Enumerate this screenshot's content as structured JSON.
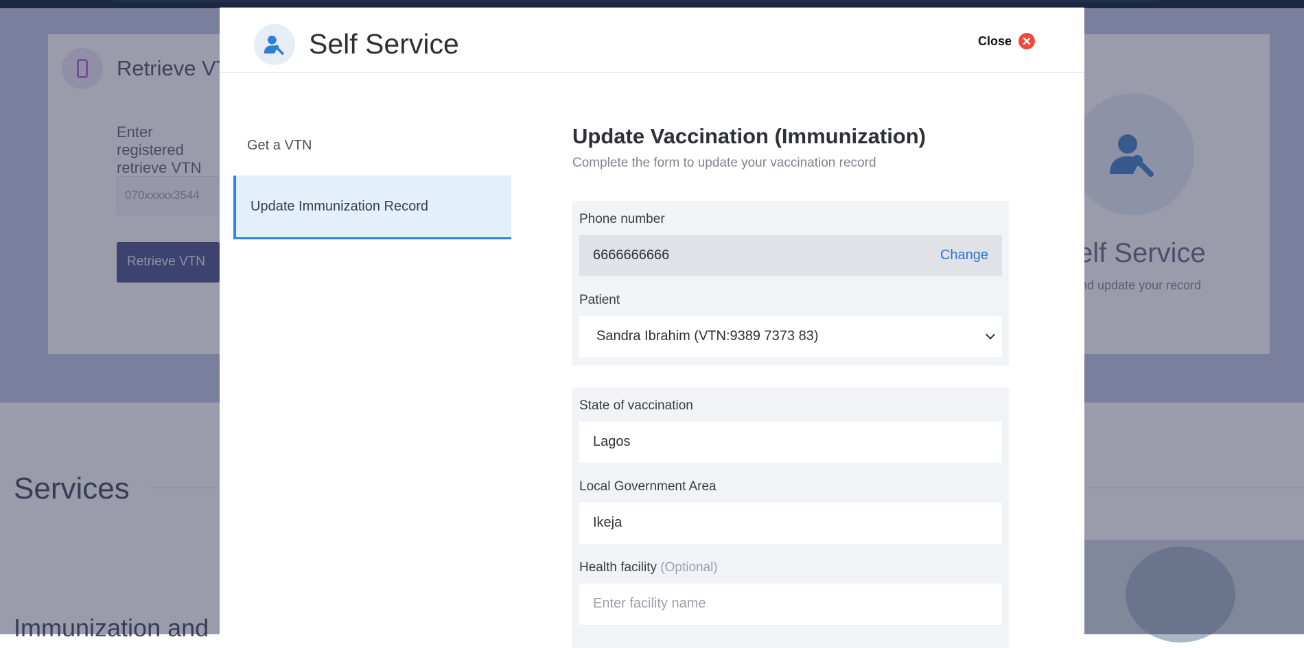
{
  "background": {
    "card_title": "Retrieve VT",
    "card_text": "Enter registered retrieve VTN",
    "input_placeholder": "070xxxxx3544",
    "button_label": "Retrieve VTN",
    "right_title": "elf Service",
    "right_subtitle": "r and update your record",
    "services_heading": "Services",
    "immunization_heading": "Immunization and"
  },
  "modal": {
    "title": "Self Service",
    "close_label": "Close",
    "nav": [
      {
        "label": "Get a VTN",
        "active": false
      },
      {
        "label": "Update Immunization Record",
        "active": true
      }
    ],
    "form": {
      "title": "Update Vaccination (Immunization)",
      "subtitle": "Complete the form to update your vaccination record",
      "phone_label": "Phone number",
      "phone_value": "6666666666",
      "change_label": "Change",
      "patient_label": "Patient",
      "patient_value": "Sandra Ibrahim (VTN:9389 7373 83)",
      "state_label": "State of vaccination",
      "state_value": "Lagos",
      "lga_label": "Local Government Area",
      "lga_value": "Ikeja",
      "facility_label": "Health facility",
      "facility_optional": "(Optional)",
      "facility_placeholder": "Enter facility name"
    }
  },
  "colors": {
    "accent": "#2a86e8",
    "link": "#2a77d4",
    "close_red": "#ef4b3a",
    "overlay": "#1e2446"
  }
}
